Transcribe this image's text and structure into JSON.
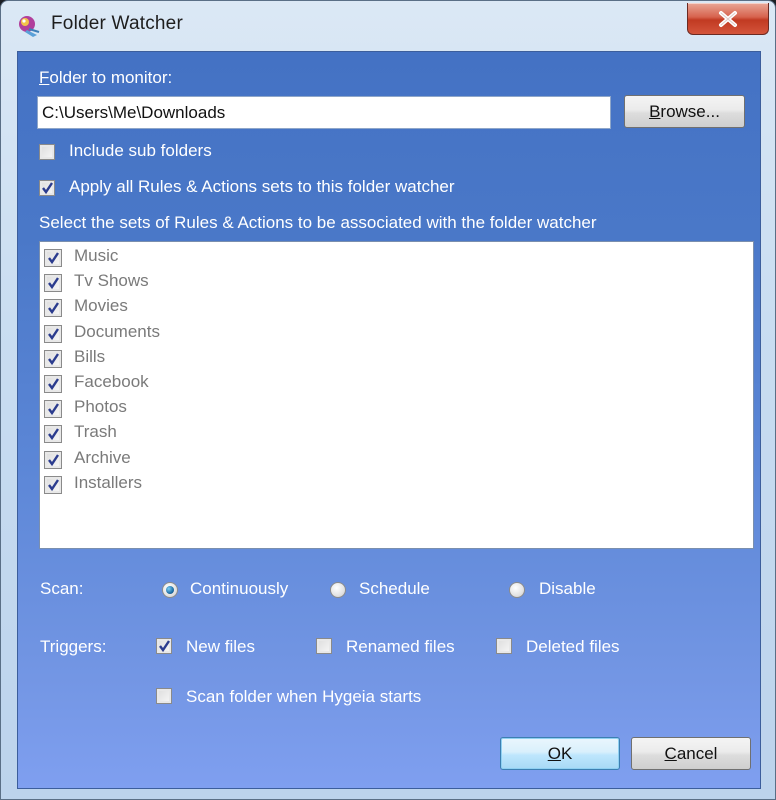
{
  "window": {
    "title": "Folder Watcher",
    "close_label": "Close"
  },
  "folder": {
    "label_prefix": "F",
    "label_rest": "older to monitor:",
    "path": "C:\\Users\\Me\\Downloads",
    "browse_prefix": "B",
    "browse_rest": "rowse..."
  },
  "options": {
    "include_sub_folders": {
      "label": "Include sub folders",
      "checked": false
    },
    "apply_all": {
      "label": "Apply all Rules & Actions sets to this folder watcher",
      "checked": true
    }
  },
  "rules": {
    "heading": "Select the sets of Rules & Actions to be associated with the folder watcher",
    "items": [
      {
        "label": "Music",
        "checked": true
      },
      {
        "label": "Tv Shows",
        "checked": true
      },
      {
        "label": "Movies",
        "checked": true
      },
      {
        "label": "Documents",
        "checked": true
      },
      {
        "label": "Bills",
        "checked": true
      },
      {
        "label": "Facebook",
        "checked": true
      },
      {
        "label": "Photos",
        "checked": true
      },
      {
        "label": "Trash",
        "checked": true
      },
      {
        "label": "Archive",
        "checked": true
      },
      {
        "label": "Installers",
        "checked": true
      }
    ]
  },
  "scan": {
    "label": "Scan:",
    "options": [
      {
        "label": "Continuously",
        "selected": true
      },
      {
        "label": "Schedule",
        "selected": false
      },
      {
        "label": "Disable",
        "selected": false
      }
    ]
  },
  "triggers": {
    "label": "Triggers:",
    "new_files": {
      "label": "New files",
      "checked": true
    },
    "renamed_files": {
      "label": "Renamed files",
      "checked": false
    },
    "deleted_files": {
      "label": "Deleted files",
      "checked": false
    },
    "scan_on_start": {
      "label": "Scan folder when Hygeia starts",
      "checked": false
    }
  },
  "buttons": {
    "ok_prefix": "O",
    "ok_rest": "K",
    "cancel_prefix": "C",
    "cancel_rest": "ancel"
  }
}
